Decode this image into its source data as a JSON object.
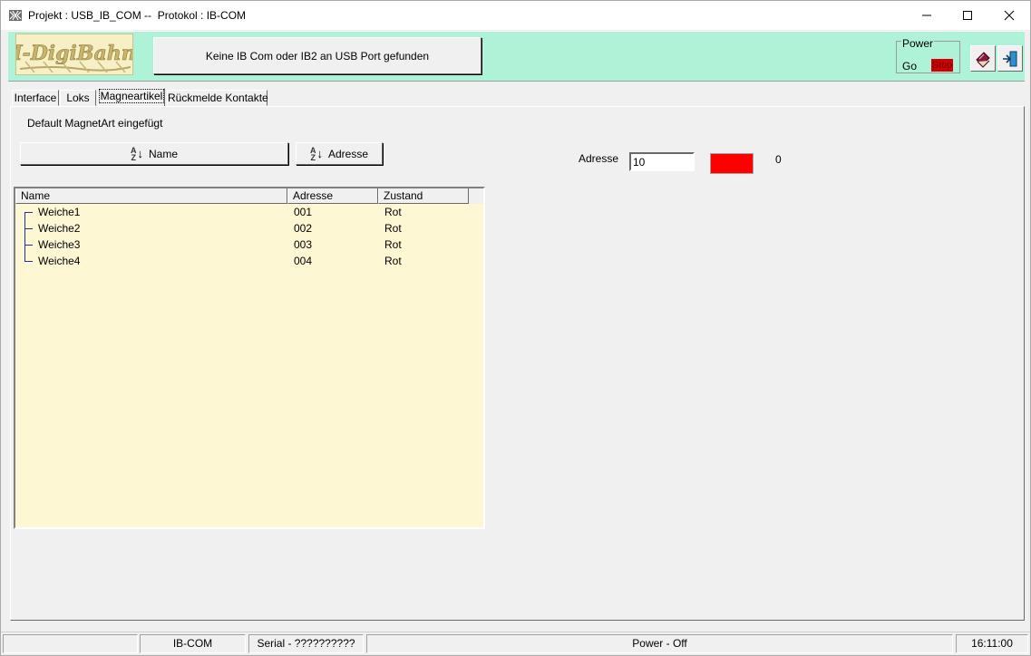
{
  "window": {
    "title": "Projekt : USB_IB_COM --  Protokol : IB-COM",
    "minimize_icon": "minimize-icon",
    "maximize_icon": "maximize-icon",
    "close_icon": "close-icon"
  },
  "header": {
    "logo_text": "I-DigiBahn",
    "status_button_label": "Keine IB Com oder IB2 an USB Port gefunden",
    "power": {
      "legend": "Power",
      "go_label": "Go",
      "stop_label": "Stop",
      "stop_color": "#d40000"
    },
    "tools": [
      {
        "icon": "book-icon"
      },
      {
        "icon": "exit-door-icon"
      }
    ],
    "band_color": "#aef2d8"
  },
  "tabs": [
    {
      "label": "Interface",
      "active": false
    },
    {
      "label": "Loks",
      "active": false
    },
    {
      "label": "Magneartikel",
      "active": true
    },
    {
      "label": "Rückmelde Kontakte",
      "active": false
    }
  ],
  "panel": {
    "info_text": "Default MagnetArt eingefügt",
    "sort_name_label": "Name",
    "sort_address_label": "Adresse",
    "sort_icon": "sort-az-icon"
  },
  "table": {
    "columns": [
      "Name",
      "Adresse",
      "Zustand"
    ],
    "rows": [
      {
        "name": "Weiche1",
        "adresse": "001",
        "zustand": "Rot"
      },
      {
        "name": "Weiche2",
        "adresse": "002",
        "zustand": "Rot"
      },
      {
        "name": "Weiche3",
        "adresse": "003",
        "zustand": "Rot"
      },
      {
        "name": "Weiche4",
        "adresse": "004",
        "zustand": "Rot"
      }
    ],
    "background_color": "#fef7d4"
  },
  "detail": {
    "address_label": "Adresse",
    "address_value": "10",
    "indicator_color": "#ff0000",
    "counter": "0"
  },
  "statusbar": {
    "cells": [
      "",
      "IB-COM",
      "Serial - ??????????",
      "Power - Off",
      "16:11:00"
    ]
  }
}
